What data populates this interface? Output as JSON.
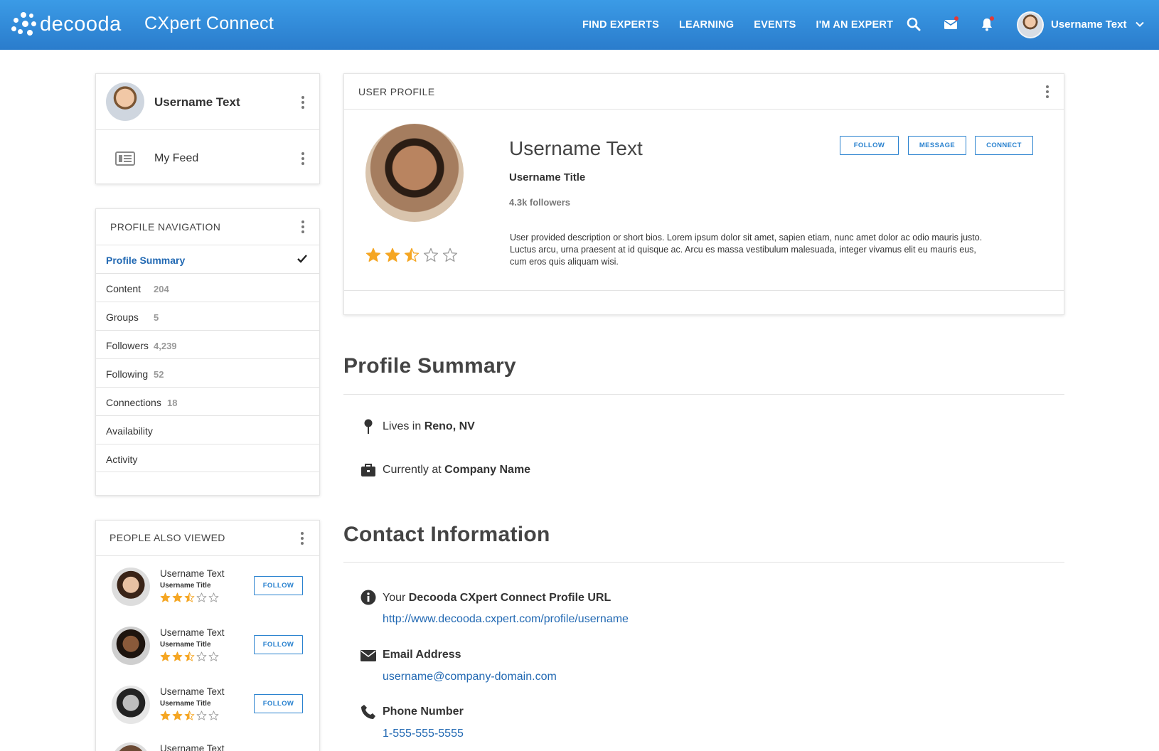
{
  "brand": {
    "logo_text": "decooda",
    "product_name": "CXpert Connect"
  },
  "top_nav": {
    "items": [
      "FIND EXPERTS",
      "LEARNING",
      "EVENTS",
      "I'M AN EXPERT"
    ],
    "username": "Username Text"
  },
  "sidebar": {
    "user_card": {
      "username": "Username Text",
      "feed_label": "My Feed"
    },
    "profile_nav": {
      "title": "PROFILE NAVIGATION",
      "items": [
        {
          "label": "Profile Summary",
          "count": "",
          "active": true
        },
        {
          "label": "Content",
          "count": "204"
        },
        {
          "label": "Groups",
          "count": "5"
        },
        {
          "label": "Followers",
          "count": "4,239"
        },
        {
          "label": "Following",
          "count": "52"
        },
        {
          "label": "Connections",
          "count": "18"
        },
        {
          "label": "Availability",
          "count": ""
        },
        {
          "label": "Activity",
          "count": ""
        }
      ]
    },
    "people_also_viewed": {
      "title": "PEOPLE ALSO VIEWED",
      "people": [
        {
          "name": "Username Text",
          "title": "Username Title",
          "rating": 2.5,
          "button": "FOLLOW"
        },
        {
          "name": "Username Text",
          "title": "Username Title",
          "rating": 2.5,
          "button": "FOLLOW"
        },
        {
          "name": "Username Text",
          "title": "Username Title",
          "rating": 2.5,
          "button": "FOLLOW"
        },
        {
          "name": "Username Text",
          "title": "",
          "rating": null,
          "button": ""
        }
      ]
    }
  },
  "profile": {
    "card_title": "USER PROFILE",
    "name": "Username Text",
    "title": "Username Title",
    "followers": "4.3k followers",
    "bio": "User provided description or short bios. Lorem ipsum dolor sit amet, sapien etiam, nunc amet dolor ac odio mauris justo. Luctus arcu, urna praesent at id quisque ac. Arcu es massa vestibulum malesuada, integer vivamus elit eu mauris eus, cum eros quis aliquam wisi.",
    "rating": 2.5,
    "buttons": {
      "follow": "FOLLOW",
      "message": "MESSAGE",
      "connect": "CONNECT"
    }
  },
  "summary": {
    "heading": "Profile Summary",
    "lives_prefix": "Lives in ",
    "location": "Reno, NV",
    "works_prefix": "Currently at ",
    "company": "Company Name"
  },
  "contact": {
    "heading": "Contact Information",
    "url_prefix": "Your ",
    "url_label": "Decooda CXpert Connect Profile URL",
    "url": "http://www.decooda.cxpert.com/profile/username",
    "email_label": "Email Address",
    "email": "username@company-domain.com",
    "phone_label": "Phone Number",
    "phone": "1-555-555-5555"
  },
  "colors": {
    "header_blue": "#2a7ccc",
    "accent_blue": "#2a82cf",
    "link_blue": "#2269b3",
    "star_orange": "#f5a623"
  }
}
